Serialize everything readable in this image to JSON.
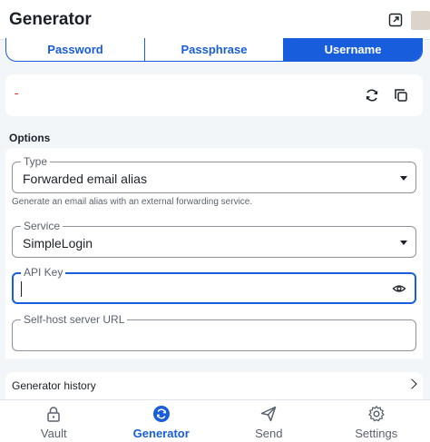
{
  "header": {
    "title": "Generator",
    "popout_icon": "popout-icon"
  },
  "tabs": [
    {
      "label": "Password",
      "active": false
    },
    {
      "label": "Passphrase",
      "active": false
    },
    {
      "label": "Username",
      "active": true
    }
  ],
  "result": {
    "value": "-",
    "regenerate_icon": "refresh-icon",
    "copy_icon": "copy-icon"
  },
  "options": {
    "section_label": "Options",
    "type": {
      "label": "Type",
      "value": "Forwarded email alias",
      "hint": "Generate an email alias with an external forwarding service."
    },
    "service": {
      "label": "Service",
      "value": "SimpleLogin"
    },
    "api_key": {
      "label": "API Key",
      "value": "",
      "toggle_icon": "eye-icon"
    },
    "self_host": {
      "label": "Self-host server URL",
      "value": ""
    }
  },
  "history": {
    "label": "Generator history"
  },
  "nav": [
    {
      "label": "Vault",
      "icon": "lock-icon",
      "active": false
    },
    {
      "label": "Generator",
      "icon": "generator-icon",
      "active": true
    },
    {
      "label": "Send",
      "icon": "send-icon",
      "active": false
    },
    {
      "label": "Settings",
      "icon": "gear-icon",
      "active": false
    }
  ],
  "colors": {
    "accent": "#175ddc",
    "background": "#f3f6f9",
    "danger_text": "#c83522"
  }
}
